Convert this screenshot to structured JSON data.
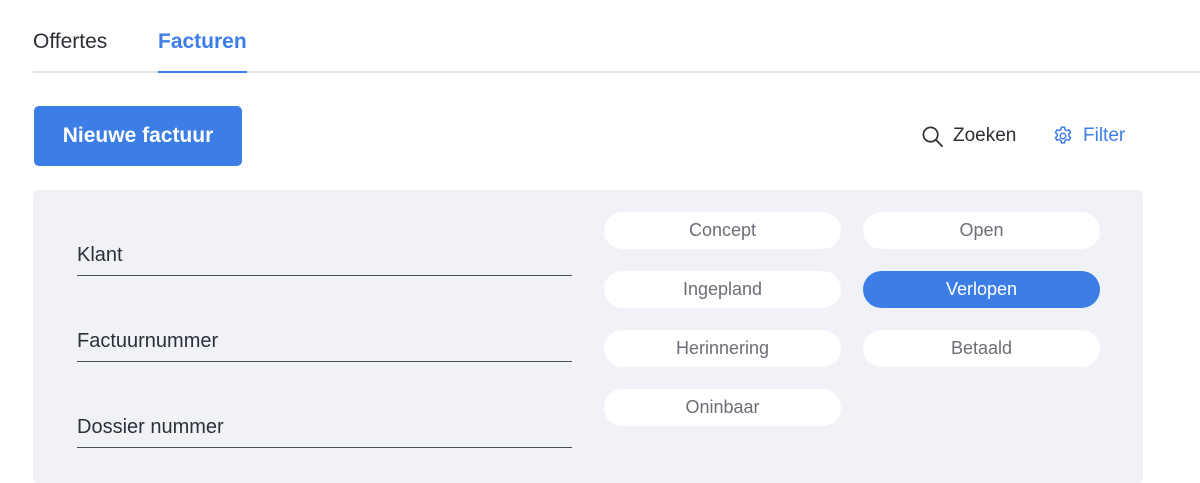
{
  "tabs": [
    {
      "label": "Offertes",
      "active": false
    },
    {
      "label": "Facturen",
      "active": true
    }
  ],
  "toolbar": {
    "new_invoice_label": "Nieuwe factuur",
    "search_label": "Zoeken",
    "filter_label": "Filter"
  },
  "filters": {
    "fields": [
      {
        "label": "Klant",
        "value": ""
      },
      {
        "label": "Factuurnummer",
        "value": ""
      },
      {
        "label": "Dossier nummer",
        "value": ""
      }
    ],
    "statuses": [
      {
        "label": "Concept",
        "selected": false
      },
      {
        "label": "Open",
        "selected": false
      },
      {
        "label": "Ingepland",
        "selected": false
      },
      {
        "label": "Verlopen",
        "selected": true
      },
      {
        "label": "Herinnering",
        "selected": false
      },
      {
        "label": "Betaald",
        "selected": false
      },
      {
        "label": "Oninbaar",
        "selected": false
      }
    ]
  },
  "colors": {
    "accent": "#3d7de6",
    "panel_background": "#f0f2f8",
    "text": "#2d2f36",
    "muted_text": "#6b6e76"
  },
  "icons": {
    "search": "search-icon",
    "filter": "gear-icon"
  }
}
